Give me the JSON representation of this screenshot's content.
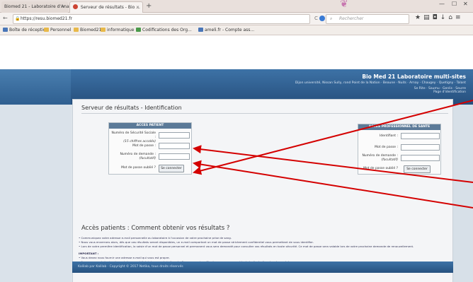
{
  "browser": {
    "tabs": [
      {
        "label": "Biomed 21 - Laboratoire d'Ana..."
      },
      {
        "label": "Serveur de résultats - Bio ..."
      }
    ],
    "new_tab": "+",
    "url": "https://resu.biomed21.fr",
    "search_placeholder": "Rechercher",
    "bookmarks": [
      {
        "label": "Boîte de réception"
      },
      {
        "label": "Personnel"
      },
      {
        "label": "Biomed21"
      },
      {
        "label": "informatique"
      },
      {
        "label": "Codifications des Org..."
      },
      {
        "label": "ameli.fr - Compte ass..."
      }
    ]
  },
  "header": {
    "title": "Bio Med 21 Laboratoire multi-sites",
    "address": "Dijon université, Nissan Sully, rond Point de la Nation · Beaune · Nuits · Arnay · Chaugey · Quetigny · Talant",
    "links_line1": "Se Rite · Saumu · Genlis · Seurre",
    "links_line2": "Page d'identification"
  },
  "main": {
    "title": "Serveur de résultats - Identification",
    "patient": {
      "header": "ACCES PATIENT",
      "ss_label_1": "Numéro de Sécurité Sociale :",
      "ss_label_2": "(15 chiffres accolés)",
      "pwd_label": "Mot de passe :",
      "req_label_1": "Numéro de demande :",
      "req_label_2": "(facultatif)",
      "forgot": "Mot de passe oublié ?",
      "connect": "Se connecter"
    },
    "pro": {
      "header": "ACCES PROFESSIONNEL DE SANTE",
      "id_label": "Identifiant :",
      "pwd_label": "Mot de passe :",
      "req_label_1": "Numéro de demande :",
      "req_label_2": "(facultatif)",
      "forgot": "Mot de passe oublié ?",
      "connect": "Se connecter"
    },
    "howto_title": "Accès patients : Comment obtenir vos résultats ?",
    "instructions": [
      "• Communiquez votre adresse e-mail personnelle au laboratoire à l'occasion de votre prochaine prise de sang.",
      "• Nous vous enverrons alors, dès que vos résultats seront disponibles, un e-mail comportant un mot de passe strictement confidentiel vous permettant de vous identifier.",
      "• Lors de votre première identification, la saisie d'un mot de passe personnel et permanent vous sera demandé pour consulter vos résultats en toute sécurité. Ce mot de passe sera valable lors de votre prochaine demande de renouvellement."
    ],
    "important_title": "IMPORTANT :",
    "important": [
      "• Vous devez nous fournir une adresse e-mail qui vous est propre.",
      "• Assurez-vous de tenir votre mot de passe à l'abri des regards indiscrets. Nous ne saurions être tenu pour responsable de la divulgation de votre mot de passe."
    ]
  },
  "footer": {
    "text": "Kalilab par Kalilab · Copyright © 2017 Netika, tous droits réservés"
  },
  "colors": {
    "header_blue": "#2f5f90",
    "panel_header": "#5b7a98",
    "arrow_red": "#d40000"
  }
}
